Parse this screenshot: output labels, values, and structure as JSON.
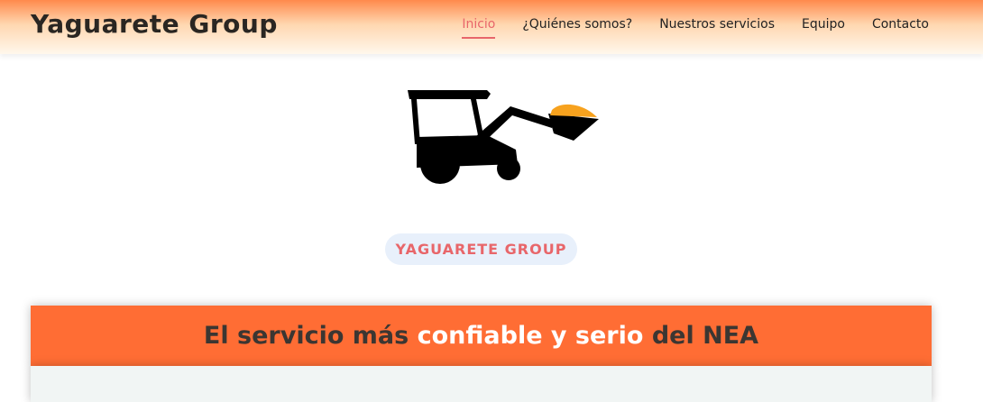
{
  "header": {
    "brand": "Yaguarete Group",
    "nav": [
      {
        "label": "Inicio",
        "active": true
      },
      {
        "label": "¿Quiénes somos?"
      },
      {
        "label": "Nuestros servicios"
      },
      {
        "label": "Equipo"
      },
      {
        "label": "Contacto"
      }
    ]
  },
  "hero": {
    "logo_icon": "loader-tractor-icon",
    "badge": "YAGUARETE GROUP"
  },
  "banner": {
    "part1": "El servicio más ",
    "part2": "confiable y serio",
    "part3": " del NEA"
  },
  "colors": {
    "accent": "#ff6d34",
    "active_link": "#e8666a",
    "badge_bg": "#e8f0fb",
    "bucket_fill": "#f7a21e"
  }
}
